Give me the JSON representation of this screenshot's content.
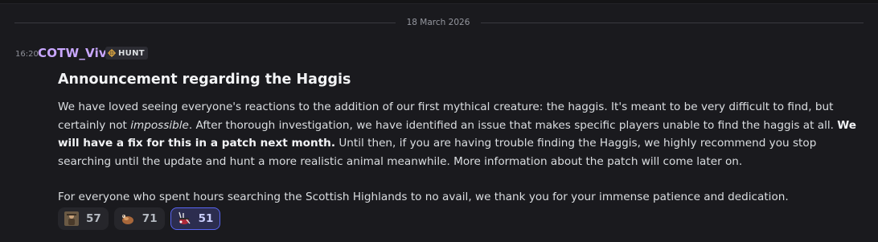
{
  "date_divider": "18 March 2026",
  "message": {
    "time": "16:20",
    "author": "COTW_Vivi",
    "tag": {
      "label": "HUNT",
      "icon": "crosshair-icon"
    },
    "heading": "Announcement regarding the Haggis",
    "p1_a": "We have loved seeing everyone's reactions to the addition of our first mythical creature: the haggis. It's meant to be very difficult to find, but certainly not ",
    "p1_em": "impossible",
    "p1_b": ". After thorough investigation, we have identified an issue that makes specific players unable to find the haggis at all. ",
    "p1_strong": "We will have a fix for this in a patch next month.",
    "p1_c": " Until then, if you are having trouble finding the Haggis, we highly recommend you stop searching until the update and hunt a more realistic animal meanwhile. More information about the patch will come later on.",
    "p2": "For everyone who spent hours searching the Scottish Highlands to no avail, we thank you for your immense patience and dedication."
  },
  "reactions": [
    {
      "emoji": "hunter-emoji",
      "count": "57",
      "active": false
    },
    {
      "emoji": "haggis-emoji",
      "count": "71",
      "active": false
    },
    {
      "emoji": "bagpipes-emoji",
      "count": "51",
      "active": true
    }
  ],
  "colors": {
    "background": "#1a1a1e",
    "username": "#c9a7ff",
    "active_reaction_border": "#5865f2"
  }
}
